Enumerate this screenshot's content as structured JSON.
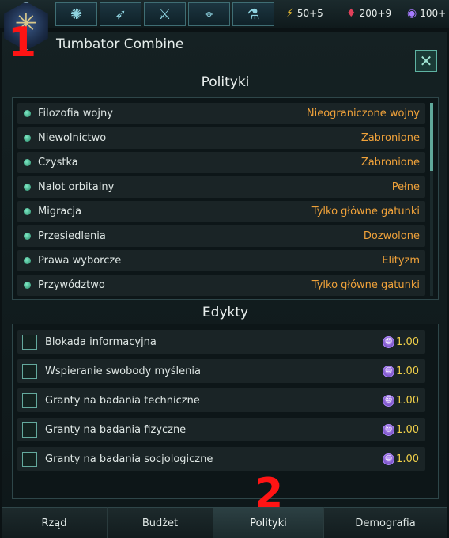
{
  "topbar": {
    "icons": [
      "galaxy-icon",
      "ships-icon",
      "army-icon",
      "map-icon",
      "research-flasks-icon"
    ],
    "resources": [
      {
        "icon": "energy-icon",
        "value": "50+5",
        "color": "#f2c230"
      },
      {
        "icon": "minerals-icon",
        "value": "200+9",
        "color": "#e0405a"
      },
      {
        "icon": "influence-icon",
        "value": "100+",
        "color": "#a77bff"
      }
    ]
  },
  "markers": {
    "first": "1",
    "second": "2"
  },
  "panel": {
    "title": "Tumbator Combine",
    "close_icon": "close-icon"
  },
  "policies": {
    "title": "Polityki",
    "items": [
      {
        "name": "Filozofia wojny",
        "value": "Nieograniczone wojny"
      },
      {
        "name": "Niewolnictwo",
        "value": "Zabronione"
      },
      {
        "name": "Czystka",
        "value": "Zabronione"
      },
      {
        "name": "Nalot orbitalny",
        "value": "Pełne"
      },
      {
        "name": "Migracja",
        "value": "Tylko główne gatunki"
      },
      {
        "name": "Przesiedlenia",
        "value": "Dozwolone"
      },
      {
        "name": "Prawa wyborcze",
        "value": "Elityzm"
      },
      {
        "name": "Przywództwo",
        "value": "Tylko główne gatunki"
      }
    ]
  },
  "edicts": {
    "title": "Edykty",
    "items": [
      {
        "name": "Blokada informacyjna",
        "cost": "1.00"
      },
      {
        "name": "Wspieranie swobody myślenia",
        "cost": "1.00"
      },
      {
        "name": "Granty na badania techniczne",
        "cost": "1.00"
      },
      {
        "name": "Granty na badania fizyczne",
        "cost": "1.00"
      },
      {
        "name": "Granty na badania socjologiczne",
        "cost": "1.00"
      }
    ]
  },
  "tabs": [
    {
      "label": "Rząd",
      "active": false
    },
    {
      "label": "Budżet",
      "active": false
    },
    {
      "label": "Polityki",
      "active": true
    },
    {
      "label": "Demografia",
      "active": false
    }
  ]
}
